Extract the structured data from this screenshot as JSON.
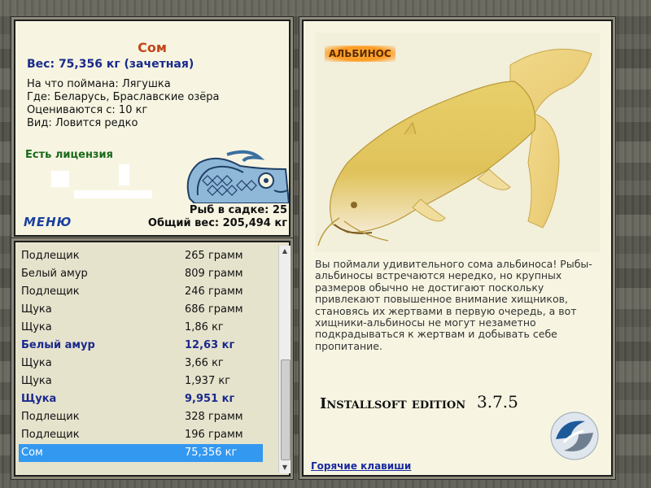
{
  "catch": {
    "fish_name": "Сом",
    "weight_line": "Вес: 75,356 кг (зачетная)",
    "bait_line": "На что поймана: Лягушка",
    "place_line": "Где: Беларусь, Браславские озёра",
    "rated_line": "Оцениваются с: 10 кг",
    "kind_line": "Вид: Ловится редко",
    "license": "Есть лицензия",
    "menu_label": "МЕНЮ",
    "cage_count": "Рыб в садке: 25",
    "total_weight": "Общий вес: 205,494 кг"
  },
  "catch_list": [
    {
      "name": "Подлещик",
      "weight": "265 грамм",
      "trophy": false
    },
    {
      "name": "Белый амур",
      "weight": "809 грамм",
      "trophy": false
    },
    {
      "name": "Подлещик",
      "weight": "246 грамм",
      "trophy": false
    },
    {
      "name": "Щука",
      "weight": "686 грамм",
      "trophy": false
    },
    {
      "name": "Щука",
      "weight": "1,86 кг",
      "trophy": false
    },
    {
      "name": "Белый амур",
      "weight": "12,63 кг",
      "trophy": true
    },
    {
      "name": "Щука",
      "weight": "3,66 кг",
      "trophy": false
    },
    {
      "name": "Щука",
      "weight": "1,937 кг",
      "trophy": false
    },
    {
      "name": "Щука",
      "weight": "9,951 кг",
      "trophy": true
    },
    {
      "name": "Подлещик",
      "weight": "328 грамм",
      "trophy": false
    },
    {
      "name": "Подлещик",
      "weight": "196 грамм",
      "trophy": false
    },
    {
      "name": "Сом",
      "weight": "75,356 кг",
      "trophy": false,
      "selected": true
    }
  ],
  "detail": {
    "badge": "АЛЬБИНОС",
    "description": "Вы поймали удивительного сома альбиноса! Рыбы-альбиносы встречаются нередко, но крупных размеров обычно не достигают поскольку привлекают повышенное внимание хищников, становясь их жертвами в первую очередь, а вот хищники-альбиносы не могут незаметно подкрадываться к жертвам и добывать себе пропитание.",
    "edition": "Installsoft edition",
    "version": "3.7.5",
    "hotkeys": "Горячие клавиши"
  },
  "colors": {
    "panel_bg": "#f7f5e2",
    "list_bg": "#e6e3cd",
    "title_orange": "#c0481a",
    "trophy_blue": "#1a2a8c",
    "license_green": "#1a6a1a",
    "selection_blue": "#3398f0"
  },
  "icons": {
    "fish_logo": "mosaic-fish-icon",
    "app_logo": "swirl-logo-icon",
    "scroll_up": "arrow-up-icon",
    "scroll_down": "arrow-down-icon"
  }
}
